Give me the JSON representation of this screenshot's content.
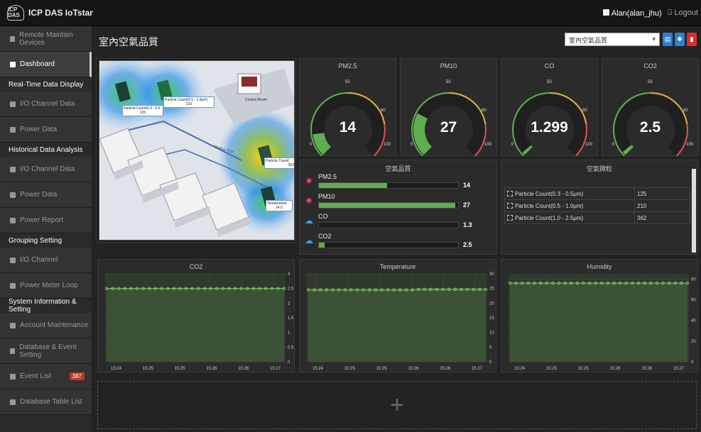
{
  "app": {
    "logo_mark": "ICP DAS",
    "title": "ICP DAS IoTstar"
  },
  "user": {
    "name": "Alan(alan_jhu)",
    "logout": "Logout"
  },
  "sidebar": {
    "items": [
      {
        "label": "Remote Maintain Devices",
        "type": "item"
      },
      {
        "label": "Dashboard",
        "type": "item",
        "active": true
      },
      {
        "label": "Real-Time Data Display",
        "type": "head"
      },
      {
        "label": "I/O Channel Data",
        "type": "item"
      },
      {
        "label": "Power Data",
        "type": "item"
      },
      {
        "label": "Historical Data Analysis",
        "type": "head"
      },
      {
        "label": "I/O Channel Data",
        "type": "item"
      },
      {
        "label": "Power Data",
        "type": "item"
      },
      {
        "label": "Power Report",
        "type": "item"
      },
      {
        "label": "Grouping Setting",
        "type": "head"
      },
      {
        "label": "I/O Channel",
        "type": "item"
      },
      {
        "label": "Power Meter Loop",
        "type": "item"
      },
      {
        "label": "System Information & Setting",
        "type": "head"
      },
      {
        "label": "Account Maintenance",
        "type": "item"
      },
      {
        "label": "Database & Event Setting",
        "type": "item"
      },
      {
        "label": "Event List",
        "type": "item",
        "badge": "387"
      },
      {
        "label": "Database Table List",
        "type": "item"
      }
    ]
  },
  "page": {
    "title": "室內空氣品質",
    "select_value": "室內空氣品質",
    "add_label": "+"
  },
  "map": {
    "labels": {
      "pc1": "Particle Count(0.3 - 0.5",
      "pc1_val": "125",
      "pc2": "Particle Count(0.5 - 1.0μm)",
      "pc2_val": "210",
      "pc3": "Particle Count(",
      "pc3_val": "362",
      "temp": "Temperature",
      "temp_val": "24.6",
      "control_room": "Control Room",
      "modbus": "Modbus TCP"
    }
  },
  "gauges": [
    {
      "title": "PM2.5",
      "value": "14",
      "num": 14,
      "max": 100
    },
    {
      "title": "PM10",
      "value": "27",
      "num": 27,
      "max": 100
    },
    {
      "title": "CO",
      "value": "1.299",
      "num": 1.299,
      "max": 100
    },
    {
      "title": "CO2",
      "value": "2.5",
      "num": 2.5,
      "max": 100
    }
  ],
  "gauge_ticks": {
    "min": "0",
    "mid": "50",
    "hi": "80",
    "max": "100"
  },
  "air_quality": {
    "title": "空氣品質",
    "rows": [
      {
        "label": "PM2.5",
        "value": "14",
        "fraction": 0.49
      },
      {
        "label": "PM10",
        "value": "27",
        "fraction": 0.98
      },
      {
        "label": "CO",
        "value": "1.3",
        "fraction": 0.0
      },
      {
        "label": "CO2",
        "value": "2.5",
        "fraction": 0.04
      }
    ]
  },
  "particles": {
    "title": "空氣微粒",
    "rows": [
      {
        "label": "Particle Count(0.3 - 0.5μm)",
        "value": "125"
      },
      {
        "label": "Particle Count(0.5 - 1.0μm)",
        "value": "210"
      },
      {
        "label": "Particle Count(1.0 - 2.5μm)",
        "value": "362"
      }
    ]
  },
  "colors": {
    "accent_green": "#5fae4f",
    "gauge_yellow": "#e0b43a",
    "gauge_red": "#d9534f",
    "btn_blue": "#2f80d1",
    "btn_red": "#d9302c"
  },
  "chart_data": [
    {
      "type": "line",
      "title": "CO2",
      "x": [
        "15:24",
        "15:25",
        "15:25",
        "15:26",
        "15:26",
        "15:27"
      ],
      "yticks": [
        "0",
        "0.5",
        "1",
        "1.5",
        "2",
        "2.5",
        "3"
      ],
      "ylim": [
        0,
        3
      ],
      "series": [
        {
          "values": [
            2.5,
            2.5,
            2.5,
            2.5,
            2.5,
            2.5,
            2.5,
            2.5,
            2.5,
            2.5,
            2.5,
            2.5,
            2.5,
            2.5,
            2.5,
            2.5,
            2.5,
            2.5,
            2.5,
            2.5,
            2.5,
            2.5,
            2.5,
            2.5,
            2.5,
            2.5,
            2.5,
            2.5,
            2.5,
            2.5
          ]
        }
      ]
    },
    {
      "type": "line",
      "title": "Temperature",
      "x": [
        "15:24",
        "15:25",
        "15:25",
        "15:26",
        "15:26",
        "15:27"
      ],
      "yticks": [
        "0",
        "5",
        "10",
        "15",
        "20",
        "25",
        "30"
      ],
      "ylim": [
        0,
        30
      ],
      "series": [
        {
          "values": [
            24.5,
            24.5,
            24.5,
            24.5,
            24.5,
            24.5,
            24.5,
            24.5,
            24.5,
            24.5,
            24.5,
            24.5,
            24.5,
            24.5,
            24.5,
            24.5,
            24.5,
            24.5,
            24.7,
            24.7,
            24.7,
            24.7,
            24.7,
            24.7,
            24.7,
            24.7,
            24.7,
            24.7,
            24.7,
            24.7
          ]
        }
      ]
    },
    {
      "type": "line",
      "title": "Humidity",
      "x": [
        "15:24",
        "15:25",
        "15:25",
        "15:26",
        "15:26",
        "15:27"
      ],
      "yticks": [
        "0",
        "20",
        "40",
        "60",
        "80"
      ],
      "ylim": [
        0,
        85
      ],
      "series": [
        {
          "values": [
            76,
            76,
            76,
            76,
            76,
            76,
            76,
            76,
            76,
            76,
            76,
            76,
            76,
            76,
            76,
            76,
            76,
            76,
            76,
            76,
            76,
            76,
            76,
            76,
            76,
            76,
            76,
            76,
            76,
            76
          ]
        }
      ]
    }
  ]
}
